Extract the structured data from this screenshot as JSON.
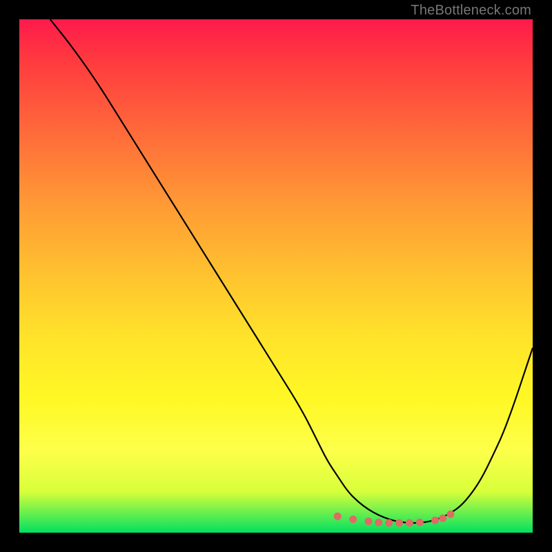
{
  "watermark": "TheBottleneck.com",
  "colors": {
    "frame": "#000000",
    "gradient_top": "#ff1a4b",
    "gradient_bottom": "#00e060",
    "curve": "#000000",
    "dots": "#e06a66"
  },
  "chart_data": {
    "type": "line",
    "title": "",
    "xlabel": "",
    "ylabel": "",
    "xlim": [
      0,
      100
    ],
    "ylim": [
      0,
      100
    ],
    "grid": false,
    "legend": false,
    "series": [
      {
        "name": "bottleneck-curve",
        "x": [
          6,
          10,
          15,
          20,
          25,
          30,
          35,
          40,
          45,
          50,
          55,
          58,
          60,
          62,
          64,
          66,
          68,
          70,
          72,
          74,
          76,
          78,
          80,
          82,
          84,
          86,
          88,
          90,
          92,
          95,
          100
        ],
        "y": [
          100,
          95,
          88,
          80,
          72,
          64,
          56,
          48,
          40,
          32,
          24,
          18,
          14,
          11,
          8,
          6,
          4.5,
          3.4,
          2.6,
          2.1,
          1.9,
          1.9,
          2.2,
          2.8,
          3.8,
          5.2,
          7.5,
          10.5,
          14.5,
          21,
          36
        ]
      },
      {
        "name": "optimal-band-markers",
        "x": [
          62,
          65,
          68,
          70,
          72,
          74,
          76,
          78,
          81,
          82.5,
          84
        ],
        "y": [
          3.2,
          2.6,
          2.2,
          2.0,
          1.9,
          1.9,
          1.9,
          2.0,
          2.4,
          2.8,
          3.6
        ]
      }
    ],
    "annotations": []
  }
}
